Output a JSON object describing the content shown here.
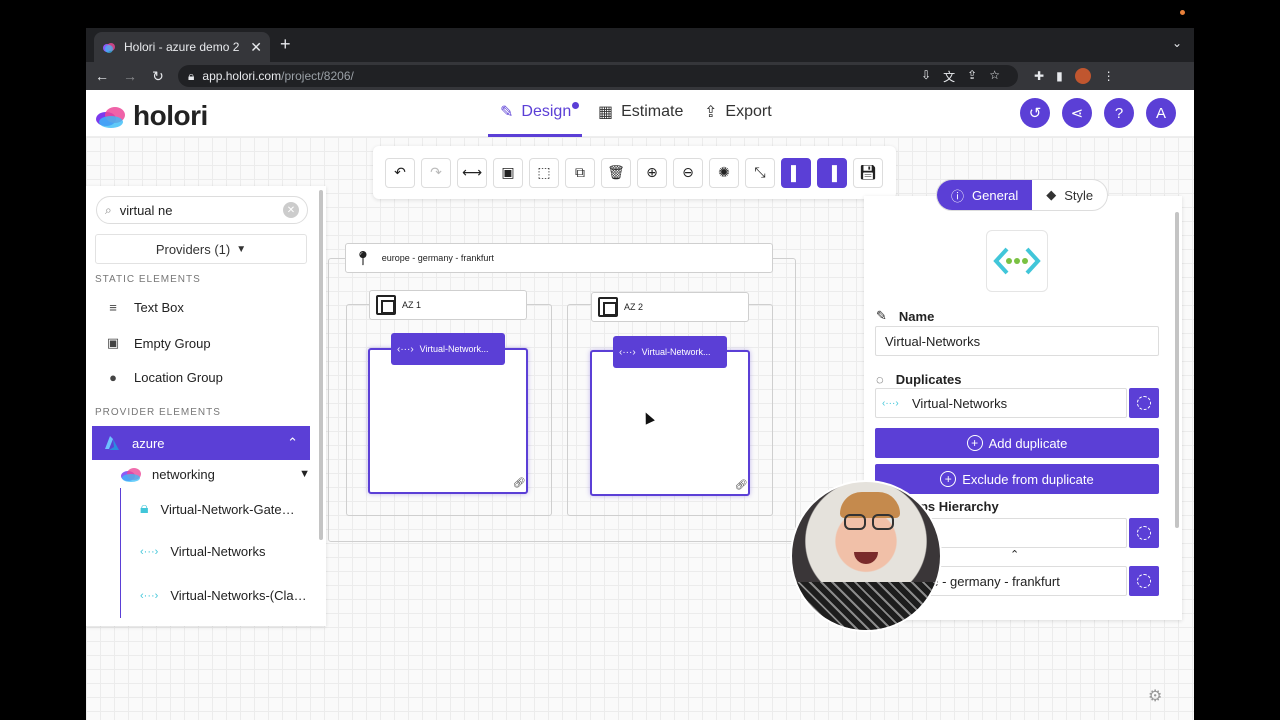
{
  "browser": {
    "tab_title": "Holori - azure demo 2",
    "tab_close": "✕",
    "new_tab": "+",
    "url_host": "app.holori.com",
    "url_path": "/project/8206/"
  },
  "app": {
    "logo_text": "holori",
    "nav": {
      "design": "Design",
      "estimate": "Estimate",
      "export": "Export"
    },
    "user_initial": "A",
    "help": "?"
  },
  "toolbar": {
    "buttons": [
      "undo-icon",
      "redo-icon",
      "connect-icon",
      "group-icon",
      "select-area-icon",
      "duplicate-icon",
      "delete-icon",
      "zoom-in-icon",
      "zoom-out-icon",
      "auto-layout-icon",
      "fit-icon",
      "left-panel-toggle-icon",
      "right-panel-toggle-icon",
      "save-icon"
    ]
  },
  "left_panel": {
    "search_value": "virtual ne",
    "providers_label": "Providers (1)",
    "static_section": "STATIC ELEMENTS",
    "static_items": [
      "Text Box",
      "Empty Group",
      "Location Group"
    ],
    "provider_section": "PROVIDER ELEMENTS",
    "provider_name": "azure",
    "category_name": "networking",
    "elements": [
      "Virtual-Network-Gate…",
      "Virtual-Networks",
      "Virtual-Networks-(Cla…"
    ]
  },
  "diagram": {
    "region_label": "europe - germany - frankfurt",
    "az1_label": "AZ 1",
    "az2_label": "AZ 2",
    "vnet1_label": "Virtual-Network...",
    "vnet2_label": "Virtual-Network..."
  },
  "right_panel": {
    "tab_general": "General",
    "tab_style": "Style",
    "name_heading": "Name",
    "name_value": "Virtual-Networks",
    "duplicates_heading": "Duplicates",
    "duplicate_value": "Virtual-Networks",
    "add_duplicate": "Add duplicate",
    "exclude_duplicate": "Exclude from duplicate",
    "hierarchy_heading": "ups Hierarchy",
    "hierarchy_region": "pe - germany - frankfurt"
  },
  "colors": {
    "accent": "#5b3fd6",
    "azure_blue": "#2a8ae0",
    "vnet_teal": "#41c6d9",
    "vnet_green": "#7ac142"
  }
}
